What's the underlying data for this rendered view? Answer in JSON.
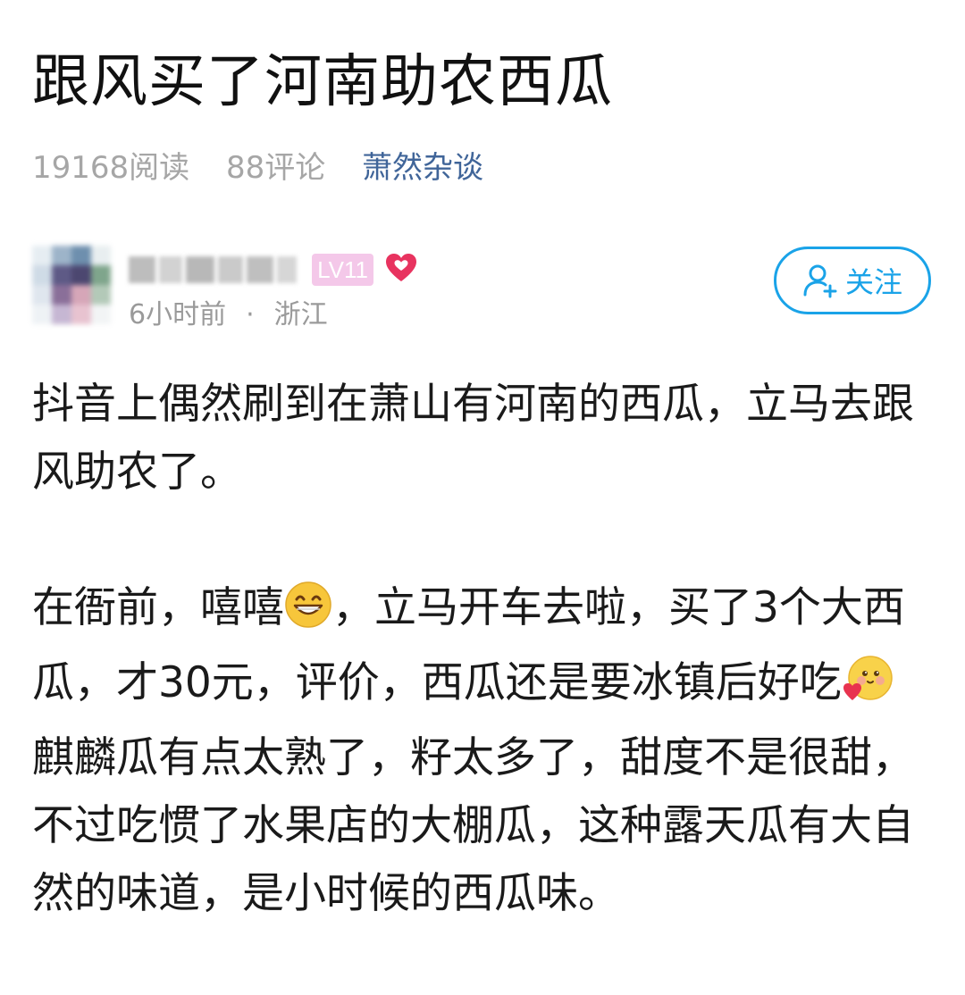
{
  "post": {
    "title": "跟风买了河南助农西瓜",
    "reads": "19168阅读",
    "comments": "88评论",
    "column": "萧然杂谈"
  },
  "author": {
    "level": "LV11",
    "time": "6小时前",
    "separator": "·",
    "location": "浙江",
    "follow_label": "关注"
  },
  "body": {
    "p1": "抖音上偶然刷到在萧山有河南的西瓜，立马去跟风助农了。",
    "p2_a": "在衙前，嘻嘻",
    "p2_b": "，立马开车去啦，买了3个大西瓜，才30元，评价，西瓜还是要冰镇后好吃",
    "p2_c": "麒麟瓜有点太熟了，籽太多了，甜度不是很甜，不过吃惯了水果店的大棚瓜，这种露天瓜有大自然的味道，是小时候的西瓜味。"
  },
  "colors": {
    "accent": "#1aa3e8",
    "link": "#406599",
    "muted": "#a6a6a6",
    "badge": "#f4c8e9",
    "heart": "#e8335f"
  },
  "icons": {
    "heart": "heart-icon",
    "follow": "add-user-icon",
    "emoji_grin": "grin-emoji-icon",
    "emoji_love": "love-emoji-icon"
  }
}
